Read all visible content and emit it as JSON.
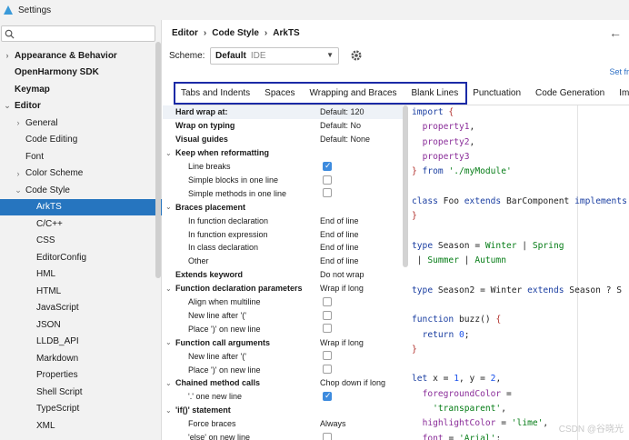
{
  "window": {
    "title": "Settings"
  },
  "sidebar": {
    "search_value": "",
    "items": [
      {
        "label": "Appearance & Behavior",
        "arrow": "›",
        "bold": true,
        "indent": 0
      },
      {
        "label": "OpenHarmony SDK",
        "arrow": "",
        "bold": true,
        "indent": 0
      },
      {
        "label": "Keymap",
        "arrow": "",
        "bold": true,
        "indent": 0
      },
      {
        "label": "Editor",
        "arrow": "⌄",
        "bold": true,
        "indent": 0
      },
      {
        "label": "General",
        "arrow": "›",
        "bold": false,
        "indent": 1
      },
      {
        "label": "Code Editing",
        "arrow": "",
        "bold": false,
        "indent": 1
      },
      {
        "label": "Font",
        "arrow": "",
        "bold": false,
        "indent": 1
      },
      {
        "label": "Color Scheme",
        "arrow": "›",
        "bold": false,
        "indent": 1
      },
      {
        "label": "Code Style",
        "arrow": "⌄",
        "bold": false,
        "indent": 1
      },
      {
        "label": "ArkTS",
        "arrow": "",
        "bold": false,
        "indent": 2,
        "selected": true
      },
      {
        "label": "C/C++",
        "arrow": "",
        "bold": false,
        "indent": 2
      },
      {
        "label": "CSS",
        "arrow": "",
        "bold": false,
        "indent": 2
      },
      {
        "label": "EditorConfig",
        "arrow": "",
        "bold": false,
        "indent": 2
      },
      {
        "label": "HML",
        "arrow": "",
        "bold": false,
        "indent": 2
      },
      {
        "label": "HTML",
        "arrow": "",
        "bold": false,
        "indent": 2
      },
      {
        "label": "JavaScript",
        "arrow": "",
        "bold": false,
        "indent": 2
      },
      {
        "label": "JSON",
        "arrow": "",
        "bold": false,
        "indent": 2
      },
      {
        "label": "LLDB_API",
        "arrow": "",
        "bold": false,
        "indent": 2
      },
      {
        "label": "Markdown",
        "arrow": "",
        "bold": false,
        "indent": 2
      },
      {
        "label": "Properties",
        "arrow": "",
        "bold": false,
        "indent": 2
      },
      {
        "label": "Shell Script",
        "arrow": "",
        "bold": false,
        "indent": 2
      },
      {
        "label": "TypeScript",
        "arrow": "",
        "bold": false,
        "indent": 2
      },
      {
        "label": "XML",
        "arrow": "",
        "bold": false,
        "indent": 2
      }
    ]
  },
  "breadcrumb": {
    "items": [
      "Editor",
      "Code Style",
      "ArkTS"
    ],
    "separator": "›"
  },
  "scheme": {
    "label": "Scheme:",
    "name": "Default",
    "kind": "IDE"
  },
  "set_from": "Set fr",
  "tabs": [
    {
      "label": "Tabs and Indents",
      "active": false
    },
    {
      "label": "Spaces",
      "active": false
    },
    {
      "label": "Wrapping and Braces",
      "active": true
    },
    {
      "label": "Blank Lines",
      "active": false
    },
    {
      "label": "Punctuation",
      "active": false
    },
    {
      "label": "Code Generation",
      "active": false
    },
    {
      "label": "Imp",
      "active": false
    }
  ],
  "options": [
    {
      "label": "Hard wrap at:",
      "bold": true,
      "level": 0,
      "value": "Default: 120",
      "shaded": true
    },
    {
      "label": "Wrap on typing",
      "bold": true,
      "level": 0,
      "value": "Default: No"
    },
    {
      "label": "Visual guides",
      "bold": true,
      "level": 0,
      "value": "Default: None"
    },
    {
      "label": "Keep when reformatting",
      "bold": true,
      "level": 0,
      "twisty": "⌄"
    },
    {
      "label": "Line breaks",
      "bold": false,
      "level": 1,
      "check": true
    },
    {
      "label": "Simple blocks in one line",
      "bold": false,
      "level": 1,
      "check": false
    },
    {
      "label": "Simple methods in one line",
      "bold": false,
      "level": 1,
      "check": false
    },
    {
      "label": "Braces placement",
      "bold": true,
      "level": 0,
      "twisty": "⌄"
    },
    {
      "label": "In function declaration",
      "bold": false,
      "level": 1,
      "value": "End of line"
    },
    {
      "label": "In function expression",
      "bold": false,
      "level": 1,
      "value": "End of line"
    },
    {
      "label": "In class declaration",
      "bold": false,
      "level": 1,
      "value": "End of line"
    },
    {
      "label": "Other",
      "bold": false,
      "level": 1,
      "value": "End of line"
    },
    {
      "label": "Extends keyword",
      "bold": true,
      "level": 0,
      "value": "Do not wrap"
    },
    {
      "label": "Function declaration parameters",
      "bold": true,
      "level": 0,
      "twisty": "⌄",
      "value": "Wrap if long"
    },
    {
      "label": "Align when multiline",
      "bold": false,
      "level": 1,
      "check": false
    },
    {
      "label": "New line after '('",
      "bold": false,
      "level": 1,
      "check": false
    },
    {
      "label": "Place ')' on new line",
      "bold": false,
      "level": 1,
      "check": false
    },
    {
      "label": "Function call arguments",
      "bold": true,
      "level": 0,
      "twisty": "⌄",
      "value": "Wrap if long"
    },
    {
      "label": "New line after '('",
      "bold": false,
      "level": 1,
      "check": false
    },
    {
      "label": "Place ')' on new line",
      "bold": false,
      "level": 1,
      "check": false
    },
    {
      "label": "Chained method calls",
      "bold": true,
      "level": 0,
      "twisty": "⌄",
      "value": "Chop down if long"
    },
    {
      "label": "'.' one new line",
      "bold": false,
      "level": 1,
      "check": true
    },
    {
      "label": "'if()' statement",
      "bold": true,
      "level": 0,
      "twisty": "⌄"
    },
    {
      "label": "Force braces",
      "bold": false,
      "level": 1,
      "value": "Always"
    },
    {
      "label": "'else' on new line",
      "bold": false,
      "level": 1,
      "check": false
    }
  ],
  "code": [
    [
      [
        "kw",
        "import"
      ],
      [
        "br",
        " {"
      ]
    ],
    [
      [
        "",
        "  "
      ],
      [
        "ident",
        "property1"
      ],
      [
        "",
        ","
      ]
    ],
    [
      [
        "",
        "  "
      ],
      [
        "ident",
        "property2"
      ],
      [
        "",
        ","
      ]
    ],
    [
      [
        "",
        "  "
      ],
      [
        "ident",
        "property3"
      ]
    ],
    [
      [
        "br",
        "}"
      ],
      [
        "kw",
        " from "
      ],
      [
        "str",
        "'./myModule'"
      ]
    ],
    [
      [
        "",
        ""
      ]
    ],
    [
      [
        "kw",
        "class"
      ],
      [
        "",
        " Foo "
      ],
      [
        "kw",
        "extends"
      ],
      [
        "",
        " BarComponent "
      ],
      [
        "kw",
        "implements"
      ]
    ],
    [
      [
        "br",
        "}"
      ]
    ],
    [
      [
        "",
        ""
      ]
    ],
    [
      [
        "kw",
        "type"
      ],
      [
        "",
        " Season = "
      ],
      [
        "str",
        "Winter"
      ],
      [
        "",
        " | "
      ],
      [
        "str",
        "Spring"
      ]
    ],
    [
      [
        "",
        "",
        " "
      ],
      [
        "",
        " | "
      ],
      [
        "str",
        "Summer"
      ],
      [
        "",
        " | "
      ],
      [
        "str",
        "Autumn"
      ]
    ],
    [
      [
        "",
        ""
      ]
    ],
    [
      [
        "kw",
        "type"
      ],
      [
        "",
        " Season2 = Winter "
      ],
      [
        "kw",
        "extends"
      ],
      [
        "",
        " Season ? S"
      ]
    ],
    [
      [
        "",
        ""
      ]
    ],
    [
      [
        "kw",
        "function"
      ],
      [
        "",
        " buzz() "
      ],
      [
        "br",
        "{"
      ]
    ],
    [
      [
        "",
        "  "
      ],
      [
        "kw",
        "return"
      ],
      [
        "num",
        " 0"
      ],
      [
        "",
        ";"
      ]
    ],
    [
      [
        "br",
        "}"
      ]
    ],
    [
      [
        "",
        ""
      ]
    ],
    [
      [
        "kw",
        "let"
      ],
      [
        "",
        " x = "
      ],
      [
        "num",
        "1"
      ],
      [
        "",
        ", y = "
      ],
      [
        "num",
        "2"
      ],
      [
        "",
        ","
      ]
    ],
    [
      [
        "",
        "  "
      ],
      [
        "ident",
        "foregroundColor"
      ],
      [
        "",
        " ="
      ]
    ],
    [
      [
        "",
        "    "
      ],
      [
        "str",
        "'transparent'"
      ],
      [
        "",
        ","
      ]
    ],
    [
      [
        "",
        "  "
      ],
      [
        "ident",
        "highlightColor"
      ],
      [
        "",
        " = "
      ],
      [
        "str",
        "'lime'"
      ],
      [
        "",
        ","
      ]
    ],
    [
      [
        "",
        "  "
      ],
      [
        "ident",
        "font"
      ],
      [
        "",
        " = "
      ],
      [
        "str",
        "'Arial'"
      ],
      [
        "",
        ";"
      ]
    ]
  ],
  "watermark": "CSDN @谷晓光",
  "colors": {
    "accent": "#2675bf",
    "highlight_border": "#1b2aa6",
    "link": "#2d6fc4"
  }
}
